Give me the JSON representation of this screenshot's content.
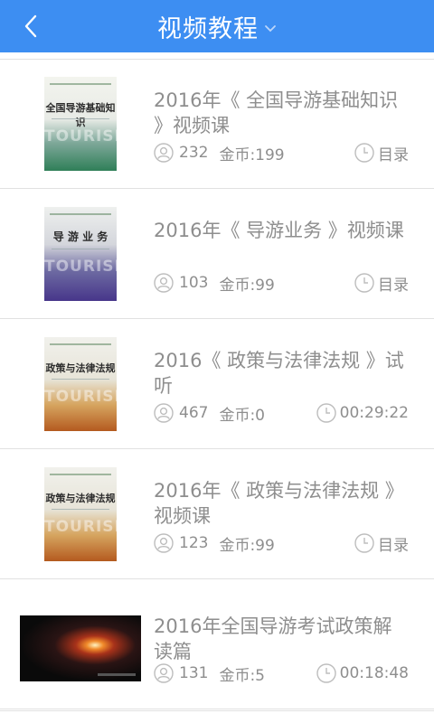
{
  "header": {
    "title": "视频教程"
  },
  "courses": [
    {
      "title": "2016年《 全国导游基础知识 》视频课",
      "views": "232",
      "coins": "金币:199",
      "right_label": "目录",
      "book_title": "全国导游基础知识",
      "cover_word": "TOURISM"
    },
    {
      "title": "2016年《 导游业务 》视频课",
      "views": "103",
      "coins": "金币:99",
      "right_label": "目录",
      "book_title": "导 游 业 务",
      "cover_word": "TOURISM"
    },
    {
      "title": "2016《 政策与法律法规 》试听",
      "views": "467",
      "coins": "金币:0",
      "right_label": "00:29:22",
      "book_title": "政策与法律法规",
      "cover_word": "TOURISM"
    },
    {
      "title": "2016年《 政策与法律法规 》视频课",
      "views": "123",
      "coins": "金币:99",
      "right_label": "目录",
      "book_title": "政策与法律法规",
      "cover_word": "TOURISM"
    },
    {
      "title": "2016年全国导游考试政策解读篇",
      "views": "131",
      "coins": "金币:5",
      "right_label": "00:18:48"
    }
  ]
}
